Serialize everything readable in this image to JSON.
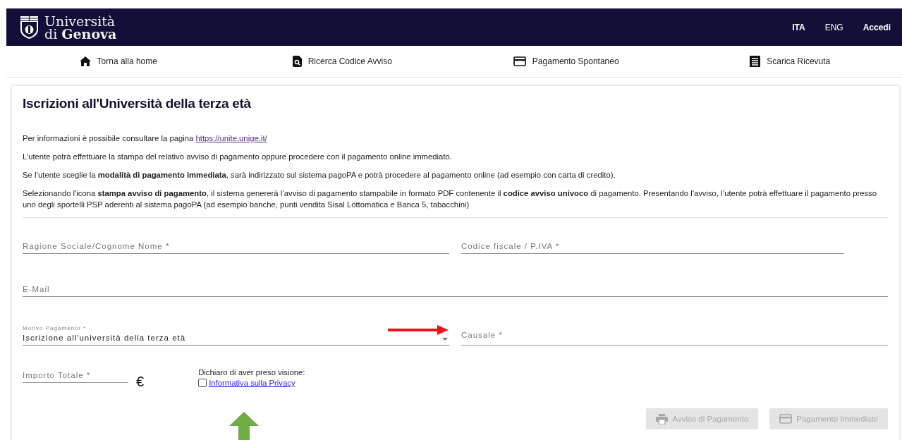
{
  "header": {
    "logo_line1": "Università",
    "logo_line2": "di **Genova**",
    "languages": [
      {
        "label": "ITA",
        "selected": true
      },
      {
        "label": "ENG",
        "selected": false
      }
    ],
    "login": "Accedi"
  },
  "nav": [
    {
      "label": "Torna alla home"
    },
    {
      "label": "Ricerca Codice Avviso"
    },
    {
      "label": "Pagamento Spontaneo"
    },
    {
      "label": "Scarica Ricevuta"
    }
  ],
  "title": "Iscrizioni all'Università della terza età",
  "intro": {
    "text": "Per informazioni è possibile consultare la pagina",
    "link": "https://unite.unige.it/"
  },
  "paragraphs": [
    "L’utente potrà effettuare la stampa del relativo avviso di pagamento oppure procedere con il pagamento online immediato.",
    "Se l’utente sceglie la **modalità di pagamento immediata**, sarà indirizzato sul sistema pagoPA e potrà procedere al pagamento online (ad esempio con carta di credito).",
    "Selezionando l'icona **stampa avviso di pagamento**, il sistema genererà l’avviso di pagamento stampabile in formato PDF contenente il **codice avviso univoco** di pagamento. Presentando l'avviso, l’utente potrà effettuare il pagamento presso uno degli sportelli PSP aderenti al sistema pagoPA (ad esempio banche, punti vendita Sisal Lottomatica e Banca 5, tabacchini)"
  ],
  "form": {
    "rows": [
      [
        {
          "kind": "input",
          "placeholder": "Ragione Sociale/Cognome Nome *"
        },
        {
          "kind": "input",
          "placeholder": "Codice fiscale / P.IVA *"
        }
      ],
      [
        {
          "kind": "input",
          "placeholder": "E-Mail"
        }
      ],
      [
        {
          "kind": "select",
          "label": "Motivo Pagamento *",
          "value": "Iscrizione all'università della terza età"
        },
        {
          "kind": "input",
          "placeholder": "Causale *"
        }
      ]
    ],
    "amount": {
      "placeholder": "Importo Totale *",
      "currency": "€"
    },
    "privacy": {
      "prompt": "Dichiaro di aver preso visione:",
      "link": "Informativa sulla Privacy",
      "checked": false
    }
  },
  "buttons": [
    {
      "label": "Avviso di Pagamento",
      "disabled": true
    },
    {
      "label": "Pagamento Immediato",
      "disabled": true
    }
  ]
}
